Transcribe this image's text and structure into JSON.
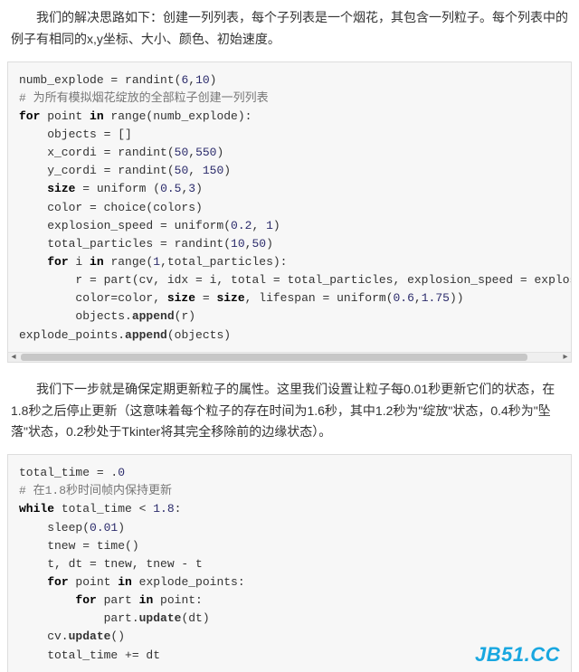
{
  "para1": "　　我们的解决思路如下：创建一列列表，每个子列表是一个烟花，其包含一列粒子。每个列表中的例子有相同的x,y坐标、大小、颜色、初始速度。",
  "para2": "　　我们下一步就是确保定期更新粒子的属性。这里我们设置让粒子每0.01秒更新它们的状态，在1.8秒之后停止更新（这意味着每个粒子的存在时间为1.6秒，其中1.2秒为\"绽放\"状态，0.4秒为\"坠落\"状态，0.2秒处于Tkinter将其完全移除前的边缘状态）。",
  "code1": {
    "l1a": "numb_explode = randint(",
    "l1n1": "6",
    "l1c": ",",
    "l1n2": "10",
    "l1b": ")",
    "l2": "# 为所有模拟烟花绽放的全部粒子创建一列列表",
    "l3a": "for",
    "l3b": " point ",
    "l3c": "in",
    "l3d": " range(numb_explode):",
    "l4": "    objects = []",
    "l5a": "    x_cordi = randint(",
    "l5n1": "50",
    "l5c": ",",
    "l5n2": "550",
    "l5b": ")",
    "l6a": "    y_cordi = randint(",
    "l6n1": "50",
    "l6c": ", ",
    "l6n2": "150",
    "l6b": ")",
    "l7a": "    ",
    "l7s": "size",
    "l7b": " = uniform (",
    "l7n1": "0.5",
    "l7c": ",",
    "l7n2": "3",
    "l7d": ")",
    "l8": "    color = choice(colors)",
    "l9a": "    explosion_speed = uniform(",
    "l9n1": "0.2",
    "l9c": ", ",
    "l9n2": "1",
    "l9b": ")",
    "l10a": "    total_particles = randint(",
    "l10n1": "10",
    "l10c": ",",
    "l10n2": "50",
    "l10b": ")",
    "l11a": "    ",
    "l11k1": "for",
    "l11b": " i ",
    "l11k2": "in",
    "l11c": " range(",
    "l11n": "1",
    "l11d": ",total_particles):",
    "l12": "        r = part(cv, idx = i, total = total_particles, explosion_speed = explosion_speed",
    "l13a": "        color=color, ",
    "l13s1": "size",
    "l13b": " = ",
    "l13s2": "size",
    "l13c": ", lifespan = uniform(",
    "l13n1": "0.6",
    "l13d": ",",
    "l13n2": "1.75",
    "l13e": "))",
    "l14a": "        objects.",
    "l14f": "append",
    "l14b": "(r)",
    "l15a": "explode_points.",
    "l15f": "append",
    "l15b": "(objects)"
  },
  "code2": {
    "l1a": "total_time = .",
    "l1n": "0",
    "l2a": "# 在",
    "l2n": "1.8",
    "l2b": "秒时间帧内保持更新",
    "l3a": "while",
    "l3b": " total_time < ",
    "l3n": "1.8",
    "l3c": ":",
    "l4a": "    sleep(",
    "l4n": "0.01",
    "l4b": ")",
    "l5": "    tnew = time()",
    "l6": "    t, dt = tnew, tnew - t",
    "l7a": "    ",
    "l7k1": "for",
    "l7b": " point ",
    "l7k2": "in",
    "l7c": " explode_points:",
    "l8a": "        ",
    "l8k1": "for",
    "l8b": " part ",
    "l8k2": "in",
    "l8c": " point:",
    "l9a": "            part.",
    "l9f": "update",
    "l9b": "(dt)",
    "l10a": "    cv.",
    "l10f": "update",
    "l10b": "()",
    "l11": "    total_time += dt"
  },
  "watermark": "JB51.CC"
}
